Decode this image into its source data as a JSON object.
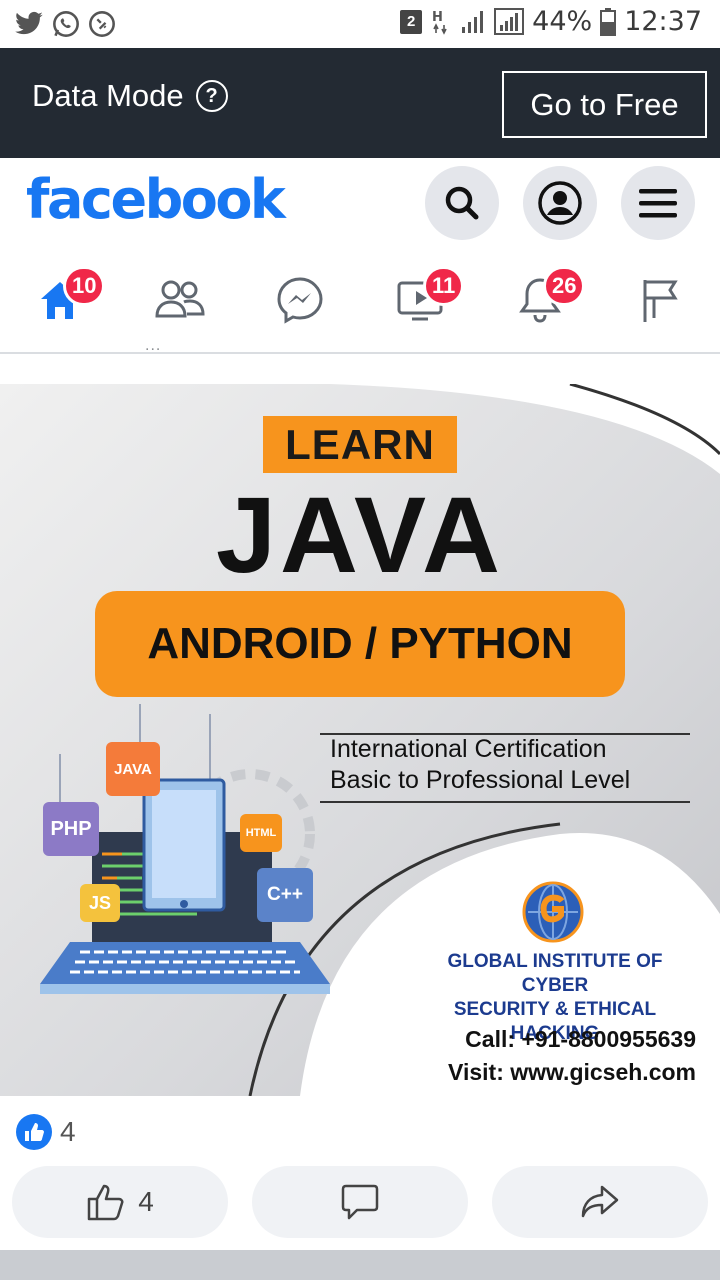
{
  "status_bar": {
    "sim_slot": "2",
    "battery": "44%",
    "time": "12:37"
  },
  "data_mode": {
    "title": "Data Mode",
    "help_icon": "help-icon",
    "go_free_label": "Go to Free"
  },
  "header": {
    "logo": "facebook",
    "buttons": [
      "search-icon",
      "profile-icon",
      "menu-icon"
    ]
  },
  "nav": {
    "items": [
      {
        "name": "home",
        "badge": "10"
      },
      {
        "name": "friends",
        "badge": ""
      },
      {
        "name": "messenger",
        "badge": ""
      },
      {
        "name": "watch",
        "badge": "11"
      },
      {
        "name": "notifications",
        "badge": "26"
      },
      {
        "name": "pages",
        "badge": ""
      }
    ],
    "dots": "..."
  },
  "post_image": {
    "learn": "LEARN",
    "java": "JAVA",
    "subjects": "ANDROID / PYTHON",
    "cert_line1": "International Certification",
    "cert_line2": "Basic to Professional Level",
    "institute_line1": "GLOBAL INSTITUTE OF CYBER",
    "institute_line2": "SECURITY & ETHICAL HACKING",
    "call": "Call: +91-8800955639",
    "visit": "Visit: www.gicseh.com",
    "tags": {
      "java": "JAVA",
      "php": "PHP",
      "js": "JS",
      "html": "HTML",
      "cpp": "C++"
    }
  },
  "reactions": {
    "count": "4"
  },
  "actions": {
    "like_count": "4"
  },
  "colors": {
    "facebook_blue": "#1877f2",
    "badge_red": "#f02849",
    "accent_orange": "#f7941d",
    "data_bar_bg": "#232a33"
  }
}
